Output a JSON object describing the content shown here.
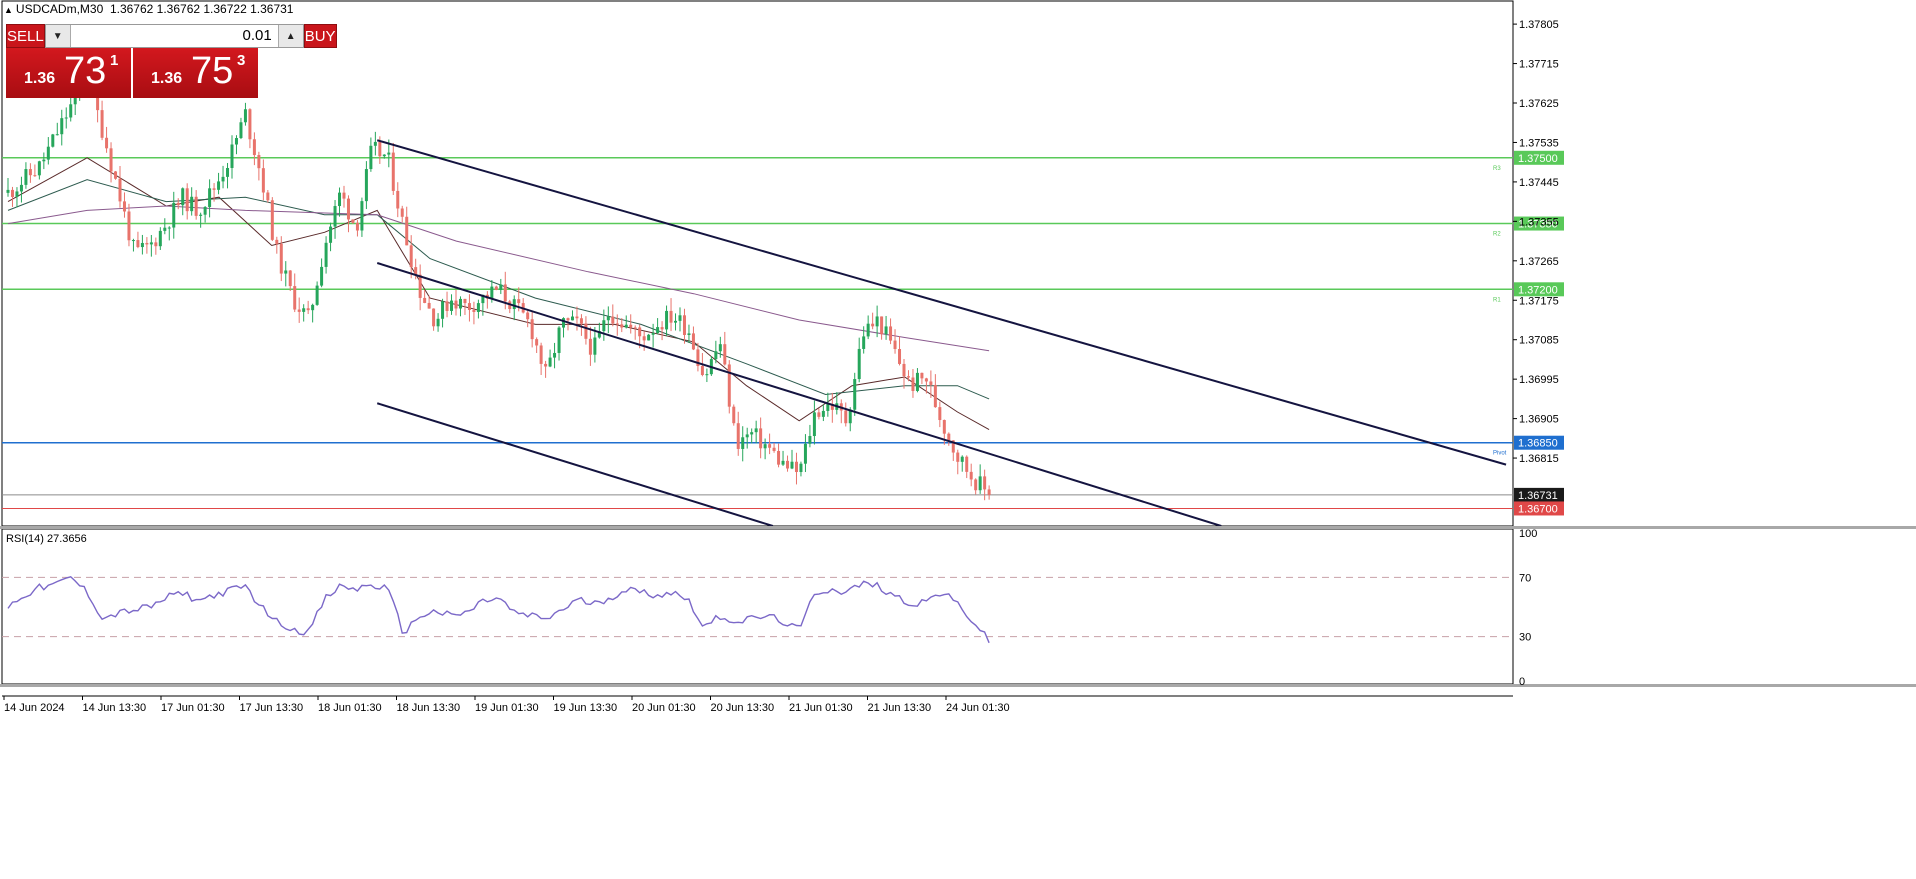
{
  "header": {
    "symbol_label": "USDCADm,M30",
    "ohlc_label": "1.36762 1.36762 1.36722 1.36731"
  },
  "trade_panel": {
    "sell_label": "SELL",
    "buy_label": "BUY",
    "lot_value": "0.01",
    "sell_quote": {
      "small": "1.36",
      "big": "73",
      "sup": "1"
    },
    "buy_quote": {
      "small": "1.36",
      "big": "75",
      "sup": "3"
    }
  },
  "colors": {
    "up_candle": "#26a65b",
    "down_candle": "#e8736b",
    "level_lines": "#59c959",
    "pivot_line": "#1f6fcf",
    "bid_line": "#8b8b8b",
    "target_line": "#e04848",
    "channel_lines": "#141440",
    "rsi_line": "#7b68c8"
  },
  "chart_data": [
    {
      "type": "candlestick",
      "title": "USDCADm,M30",
      "y_range": [
        1.3666,
        1.3786
      ],
      "y_ticks": [
        "1.37805",
        "1.37715",
        "1.37625",
        "1.37535",
        "1.37445",
        "1.37355",
        "1.37265",
        "1.37175",
        "1.37085",
        "1.36995",
        "1.36905",
        "1.36815"
      ],
      "x_ticks": [
        "14 Jun 2024",
        "14 Jun 13:30",
        "17 Jun 01:30",
        "17 Jun 13:30",
        "18 Jun 01:30",
        "18 Jun 13:30",
        "19 Jun 01:30",
        "19 Jun 13:30",
        "20 Jun 01:30",
        "20 Jun 13:30",
        "21 Jun 01:30",
        "21 Jun 13:30",
        "24 Jun 01:30"
      ],
      "price_path": [
        [
          0,
          1.3742
        ],
        [
          6,
          1.3748
        ],
        [
          12,
          1.3762
        ],
        [
          15,
          1.3768
        ],
        [
          18,
          1.3756
        ],
        [
          21,
          1.3742
        ],
        [
          24,
          1.3728
        ],
        [
          27,
          1.373
        ],
        [
          30,
          1.3735
        ],
        [
          33,
          1.3741
        ],
        [
          36,
          1.3738
        ],
        [
          39,
          1.3743
        ],
        [
          42,
          1.375
        ],
        [
          45,
          1.376
        ],
        [
          48,
          1.3746
        ],
        [
          51,
          1.3728
        ],
        [
          54,
          1.3718
        ],
        [
          57,
          1.3713
        ],
        [
          60,
          1.373
        ],
        [
          63,
          1.3742
        ],
        [
          66,
          1.3734
        ],
        [
          69,
          1.3752
        ],
        [
          72,
          1.375
        ],
        [
          75,
          1.3734
        ],
        [
          78,
          1.372
        ],
        [
          81,
          1.3713
        ],
        [
          84,
          1.3718
        ],
        [
          87,
          1.3716
        ],
        [
          90,
          1.3718
        ],
        [
          93,
          1.372
        ],
        [
          96,
          1.3716
        ],
        [
          99,
          1.3712
        ],
        [
          102,
          1.37
        ],
        [
          105,
          1.3712
        ],
        [
          108,
          1.3712
        ],
        [
          111,
          1.3706
        ],
        [
          114,
          1.3715
        ],
        [
          117,
          1.3712
        ],
        [
          120,
          1.3709
        ],
        [
          123,
          1.3712
        ],
        [
          126,
          1.3714
        ],
        [
          129,
          1.3711
        ],
        [
          132,
          1.37
        ],
        [
          135,
          1.3708
        ],
        [
          138,
          1.3685
        ],
        [
          141,
          1.3687
        ],
        [
          144,
          1.3684
        ],
        [
          147,
          1.368
        ],
        [
          150,
          1.3678
        ],
        [
          153,
          1.3692
        ],
        [
          156,
          1.3694
        ],
        [
          159,
          1.369
        ],
        [
          162,
          1.371
        ],
        [
          165,
          1.3713
        ],
        [
          168,
          1.3706
        ],
        [
          171,
          1.3698
        ],
        [
          174,
          1.37
        ],
        [
          177,
          1.369
        ],
        [
          180,
          1.3682
        ],
        [
          183,
          1.3677
        ],
        [
          186,
          1.3673
        ]
      ],
      "ma_fast": [
        [
          0,
          1.374
        ],
        [
          15,
          1.375
        ],
        [
          30,
          1.3739
        ],
        [
          40,
          1.3741
        ],
        [
          50,
          1.373
        ],
        [
          60,
          1.3733
        ],
        [
          70,
          1.3738
        ],
        [
          80,
          1.3718
        ],
        [
          100,
          1.3712
        ],
        [
          115,
          1.3712
        ],
        [
          130,
          1.3708
        ],
        [
          140,
          1.3698
        ],
        [
          150,
          1.369
        ],
        [
          160,
          1.3698
        ],
        [
          170,
          1.37
        ],
        [
          180,
          1.3692
        ],
        [
          186,
          1.3688
        ]
      ],
      "ma_mid": [
        [
          0,
          1.3738
        ],
        [
          15,
          1.3745
        ],
        [
          30,
          1.374
        ],
        [
          45,
          1.3741
        ],
        [
          60,
          1.3737
        ],
        [
          70,
          1.3737
        ],
        [
          80,
          1.3727
        ],
        [
          100,
          1.3718
        ],
        [
          120,
          1.3712
        ],
        [
          140,
          1.3703
        ],
        [
          155,
          1.3696
        ],
        [
          170,
          1.3698
        ],
        [
          180,
          1.3698
        ],
        [
          186,
          1.3695
        ]
      ],
      "ma_slow": [
        [
          0,
          1.3735
        ],
        [
          15,
          1.3738
        ],
        [
          30,
          1.3739
        ],
        [
          45,
          1.3738
        ],
        [
          70,
          1.3737
        ],
        [
          85,
          1.3731
        ],
        [
          110,
          1.3724
        ],
        [
          130,
          1.3719
        ],
        [
          150,
          1.3713
        ],
        [
          170,
          1.3709
        ],
        [
          186,
          1.3706
        ]
      ],
      "levels": [
        {
          "name": "R3",
          "value": 1.375,
          "label": "1.37500",
          "tag": "R3"
        },
        {
          "name": "R2",
          "value": 1.3735,
          "label": "1.37350",
          "tag": "R2"
        },
        {
          "name": "R1",
          "value": 1.372,
          "label": "1.37200",
          "tag": "R1"
        },
        {
          "name": "Pivot",
          "value": 1.3685,
          "label": "1.36850",
          "tag": "Pivot"
        }
      ],
      "current_price": {
        "value": 1.36731,
        "label": "1.36731"
      },
      "target_price": {
        "value": 1.367,
        "label": "1.36700"
      },
      "channel_lines": [
        {
          "from": [
            70,
            1.3754
          ],
          "to": [
            284,
            1.368
          ]
        },
        {
          "from": [
            70,
            1.3726
          ],
          "to": [
            230,
            1.3666
          ]
        },
        {
          "from": [
            70,
            1.3694
          ],
          "to": [
            145,
            1.3666
          ]
        }
      ]
    },
    {
      "type": "line",
      "title": "RSI(14) 27.3656",
      "y_range": [
        0,
        100
      ],
      "y_ticks": [
        "100",
        "70",
        "30",
        "0"
      ],
      "levels": [
        70,
        30
      ],
      "series": [
        {
          "name": "RSI(14)",
          "points": [
            [
              0,
              50
            ],
            [
              3,
              58
            ],
            [
              6,
              63
            ],
            [
              9,
              65
            ],
            [
              12,
              70
            ],
            [
              15,
              60
            ],
            [
              18,
              42
            ],
            [
              21,
              46
            ],
            [
              24,
              48
            ],
            [
              27,
              50
            ],
            [
              30,
              56
            ],
            [
              33,
              60
            ],
            [
              36,
              54
            ],
            [
              39,
              58
            ],
            [
              42,
              61
            ],
            [
              45,
              64
            ],
            [
              48,
              50
            ],
            [
              51,
              40
            ],
            [
              54,
              35
            ],
            [
              57,
              33
            ],
            [
              60,
              55
            ],
            [
              63,
              64
            ],
            [
              66,
              62
            ],
            [
              69,
              65
            ],
            [
              72,
              62
            ],
            [
              75,
              32
            ],
            [
              78,
              44
            ],
            [
              81,
              47
            ],
            [
              84,
              44
            ],
            [
              87,
              46
            ],
            [
              90,
              54
            ],
            [
              93,
              56
            ],
            [
              96,
              46
            ],
            [
              99,
              44
            ],
            [
              102,
              42
            ],
            [
              105,
              48
            ],
            [
              108,
              55
            ],
            [
              111,
              52
            ],
            [
              114,
              56
            ],
            [
              117,
              62
            ],
            [
              120,
              60
            ],
            [
              123,
              58
            ],
            [
              126,
              60
            ],
            [
              129,
              55
            ],
            [
              132,
              36
            ],
            [
              135,
              44
            ],
            [
              138,
              40
            ],
            [
              141,
              42
            ],
            [
              144,
              44
            ],
            [
              147,
              40
            ],
            [
              150,
              34
            ],
            [
              153,
              60
            ],
            [
              156,
              62
            ],
            [
              159,
              60
            ],
            [
              162,
              66
            ],
            [
              165,
              64
            ],
            [
              168,
              58
            ],
            [
              171,
              52
            ],
            [
              174,
              54
            ],
            [
              177,
              60
            ],
            [
              180,
              52
            ],
            [
              183,
              40
            ],
            [
              186,
              27
            ]
          ]
        }
      ]
    }
  ]
}
